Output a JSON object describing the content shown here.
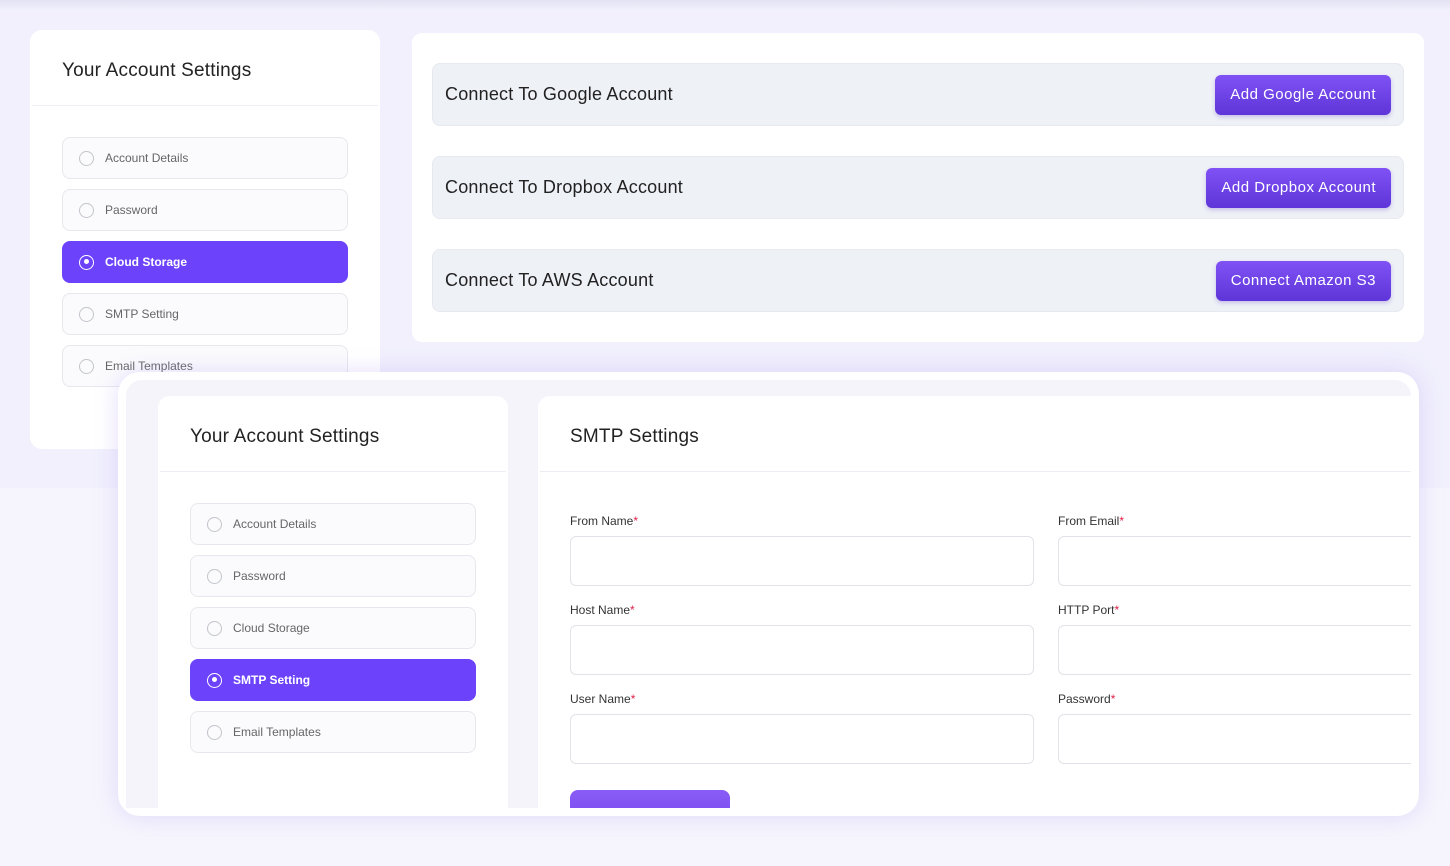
{
  "colors": {
    "accent": "#6c43fb",
    "required": "#e0214a",
    "row_bg": "#eef1f6"
  },
  "back_screen": {
    "sidebar": {
      "title": "Your Account Settings",
      "items": [
        {
          "label": "Account Details",
          "active": false
        },
        {
          "label": "Password",
          "active": false
        },
        {
          "label": "Cloud Storage",
          "active": true
        },
        {
          "label": "SMTP Setting",
          "active": false
        },
        {
          "label": "Email Templates",
          "active": false
        }
      ]
    },
    "cloud": {
      "rows": [
        {
          "label": "Connect To Google Account",
          "button": "Add Google Account"
        },
        {
          "label": "Connect To Dropbox Account",
          "button": "Add Dropbox Account"
        },
        {
          "label": "Connect To AWS Account",
          "button": "Connect Amazon S3"
        }
      ]
    }
  },
  "front_screen": {
    "sidebar": {
      "title": "Your Account Settings",
      "items": [
        {
          "label": "Account Details",
          "active": false
        },
        {
          "label": "Password",
          "active": false
        },
        {
          "label": "Cloud Storage",
          "active": false
        },
        {
          "label": "SMTP Setting",
          "active": true
        },
        {
          "label": "Email Templates",
          "active": false
        }
      ]
    },
    "smtp": {
      "title": "SMTP Settings",
      "required_mark": "*",
      "fields": [
        {
          "label": "From Name",
          "value": "",
          "placeholder": ""
        },
        {
          "label": "From Email",
          "value": "",
          "placeholder": ""
        },
        {
          "label": "Host Name",
          "value": "",
          "placeholder": ""
        },
        {
          "label": "HTTP Port",
          "value": "",
          "placeholder": ""
        },
        {
          "label": "User Name",
          "value": "",
          "placeholder": ""
        },
        {
          "label": "Password",
          "value": "",
          "placeholder": ""
        }
      ]
    }
  }
}
